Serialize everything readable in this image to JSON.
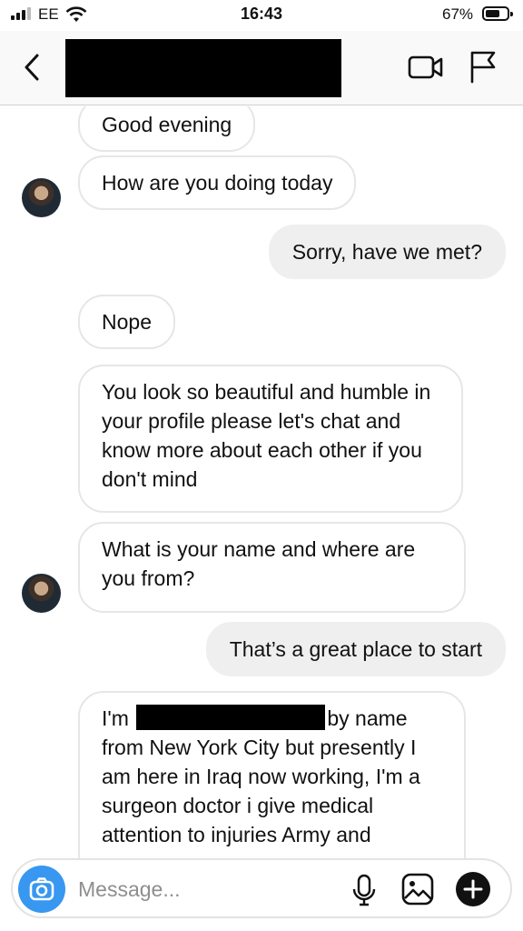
{
  "status_bar": {
    "carrier": "EE",
    "time": "16:43",
    "battery_percent": "67%",
    "battery_level": 0.67
  },
  "header": {
    "icons": [
      "back-icon",
      "video-call-icon",
      "flag-icon"
    ]
  },
  "messages": [
    {
      "side": "in",
      "text": "Good evening"
    },
    {
      "side": "in",
      "text": "How are you doing today"
    },
    {
      "side": "out",
      "text": "Sorry, have we met?"
    },
    {
      "side": "in",
      "text": "Nope"
    },
    {
      "side": "in",
      "text": "You look so beautiful and humble in your profile please let's chat and know more about each other if you don't mind"
    },
    {
      "side": "in",
      "text": "What is your name and where are you from?"
    },
    {
      "side": "out",
      "text": "That’s a great place to start"
    },
    {
      "side": "in",
      "text_before": "I'm",
      "text_after": "by name",
      "text_rest": "from New York City but presently I am here in Iraq now working, I'm a surgeon doctor i give medical attention to injuries Army and"
    }
  ],
  "composer": {
    "placeholder": "Message...",
    "icons": [
      "camera-icon",
      "microphone-icon",
      "gallery-icon",
      "plus-icon"
    ]
  },
  "colors": {
    "accent": "#3897f0",
    "outgoing_bubble": "#efefef",
    "incoming_border": "#e6e6e6"
  }
}
